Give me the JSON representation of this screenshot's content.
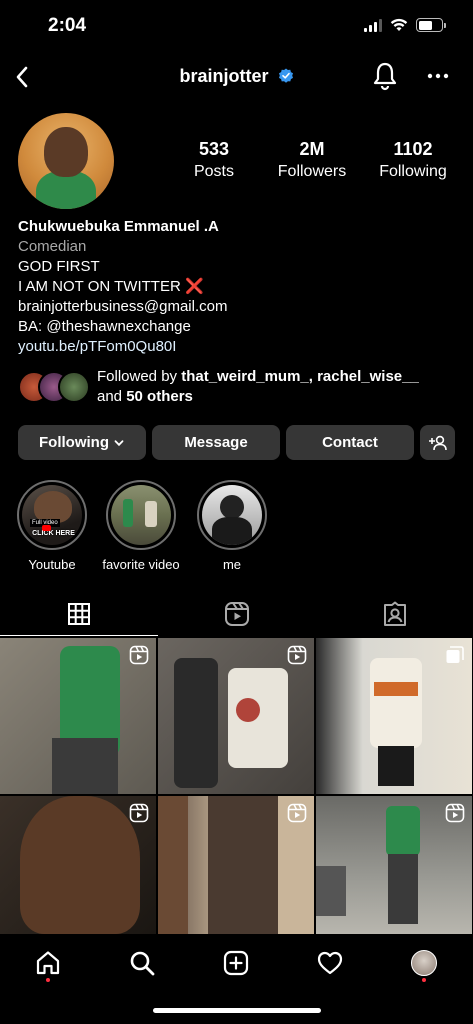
{
  "status_bar": {
    "time": "2:04"
  },
  "header": {
    "username": "brainjotter",
    "verified": true,
    "accent_color": "#3897f0"
  },
  "stats": [
    {
      "value": "533",
      "label": "Posts"
    },
    {
      "value": "2M",
      "label": "Followers"
    },
    {
      "value": "1102",
      "label": "Following"
    }
  ],
  "bio": {
    "name": "Chukwuebuka Emmanuel .A",
    "category": "Comedian",
    "lines": [
      "GOD FIRST",
      "I AM NOT ON TWITTER",
      "brainjotterbusiness@gmail.com",
      "BA: @theshawnexchange"
    ],
    "x_emoji": "❌",
    "link": "youtu.be/pTFom0Qu80I"
  },
  "followed_by": {
    "prefix": "Followed by ",
    "names": "that_weird_mum_, rachel_wise__",
    "and": "and ",
    "others": "50 others"
  },
  "actions": {
    "following": "Following",
    "message": "Message",
    "contact": "Contact"
  },
  "highlights": [
    {
      "label": "Youtube",
      "overlay": "CLICK HERE",
      "tag": "Full video"
    },
    {
      "label": "favorite video"
    },
    {
      "label": "me"
    }
  ],
  "tabs": [
    {
      "icon": "grid-icon",
      "active": true
    },
    {
      "icon": "reels-icon",
      "active": false
    },
    {
      "icon": "tagged-icon",
      "active": false
    }
  ],
  "grid_posts": [
    {
      "type": "reel",
      "colors": [
        "#7a7468",
        "#2d8a4c",
        "#4a4a4a"
      ]
    },
    {
      "type": "reel",
      "colors": [
        "#6b6660",
        "#b0443a",
        "#333333"
      ]
    },
    {
      "type": "carousel",
      "colors": [
        "#d9d8d2",
        "#e8e2d5",
        "#222222"
      ]
    },
    {
      "type": "reel",
      "colors": [
        "#2a2520",
        "#5a3a26",
        "#3a3030"
      ]
    },
    {
      "type": "reel",
      "colors": [
        "#5a4a40",
        "#c9b59a",
        "#2a2a2a"
      ]
    },
    {
      "type": "reel",
      "colors": [
        "#8a8a84",
        "#2d8a4c",
        "#3a3a3a"
      ]
    }
  ],
  "bottom_nav": [
    "home-icon",
    "search-icon",
    "new-post-icon",
    "activity-heart-icon",
    "profile-avatar"
  ],
  "colors": {
    "button_bg": "#363636",
    "notification_dot": "#ff3040",
    "secondary_text": "#a8a8a8"
  }
}
